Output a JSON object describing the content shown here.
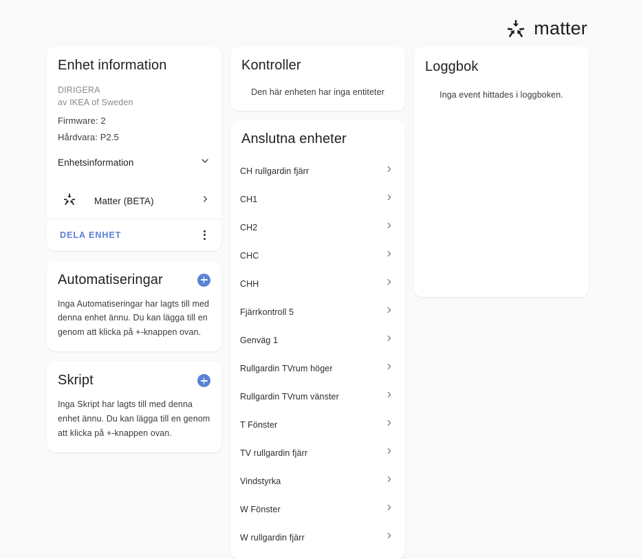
{
  "brand": {
    "name": "matter",
    "mark_icon": "matter-logo-icon"
  },
  "device_info": {
    "title": "Enhet information",
    "model": "DIRIGERA",
    "manufacturer": "av IKEA of Sweden",
    "firmware": "Firmware: 2",
    "hardware": "Hårdvara: P2.5",
    "expander_label": "Enhetsinformation",
    "matter_row_label": "Matter (BETA)",
    "share_button": "DELA ENHET"
  },
  "automations": {
    "title": "Automatiseringar",
    "empty_text": "Inga Automatiseringar har lagts till med denna enhet ännu. Du kan lägga till en genom att klicka på +-knappen ovan.",
    "add_label": "+"
  },
  "scripts": {
    "title": "Skript",
    "empty_text": "Inga Skript har lagts till med denna enhet ännu. Du kan lägga till en genom att klicka på +-knappen ovan.",
    "add_label": "+"
  },
  "controllers": {
    "title": "Kontroller",
    "empty_text": "Den här enheten har inga entiteter"
  },
  "connected_devices": {
    "title": "Anslutna enheter",
    "items": [
      {
        "label": "CH rullgardin fjärr"
      },
      {
        "label": "CH1"
      },
      {
        "label": "CH2"
      },
      {
        "label": "CHC"
      },
      {
        "label": "CHH"
      },
      {
        "label": "Fjärrkontroll 5"
      },
      {
        "label": "Genväg 1"
      },
      {
        "label": "Rullgardin TVrum höger"
      },
      {
        "label": "Rullgardin TVrum vänster"
      },
      {
        "label": "T Fönster"
      },
      {
        "label": "TV rullgardin fjärr"
      },
      {
        "label": "Vindstyrka"
      },
      {
        "label": "W Fönster"
      },
      {
        "label": "W rullgardin fjärr"
      }
    ]
  },
  "logbook": {
    "title": "Loggbok",
    "empty_text": "Inga event hittades i loggboken."
  },
  "colors": {
    "accent_blue": "#5c82d6",
    "link_blue": "#5a7fd4",
    "page_background": "#fafafa",
    "card_background": "#ffffff",
    "text_primary": "#212121",
    "text_muted": "#8a8a8a"
  }
}
